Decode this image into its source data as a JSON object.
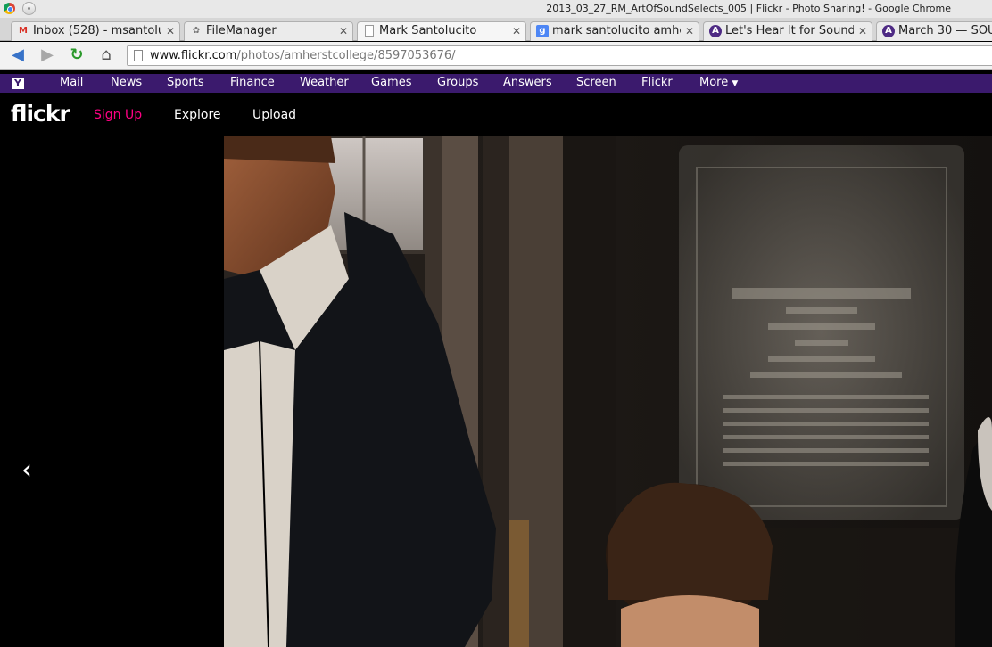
{
  "window": {
    "title": "2013_03_27_RM_ArtOfSoundSelects_005 | Flickr - Photo Sharing! - Google Chrome"
  },
  "tabs": [
    {
      "label": "Inbox (528) - msantolu",
      "icon": "gmail-icon"
    },
    {
      "label": "FileManager",
      "icon": "filemanager-icon"
    },
    {
      "label": "Mark Santolucito",
      "icon": "page-icon"
    },
    {
      "label": "mark santolucito amhe",
      "icon": "google-icon",
      "icon_glyph": "g"
    },
    {
      "label": "Let's Hear It for Sound",
      "icon": "amherst-icon",
      "icon_glyph": "A"
    },
    {
      "label": "March 30 — SOU",
      "icon": "amherst-icon",
      "icon_glyph": "A"
    }
  ],
  "toolbar": {
    "url_host": "www.flickr.com",
    "url_path": "/photos/amherstcollege/8597053676/"
  },
  "yahoo_bar": {
    "logo": "Y",
    "links": [
      "Mail",
      "News",
      "Sports",
      "Finance",
      "Weather",
      "Games",
      "Groups",
      "Answers",
      "Screen",
      "Flickr",
      "More"
    ]
  },
  "flickr_header": {
    "logo": "flickr",
    "sign_up": "Sign Up",
    "explore": "Explore",
    "upload": "Upload"
  },
  "photo": {
    "prev_arrow": "‹"
  },
  "colors": {
    "yahoo_purple": "#3b1a6d",
    "flickr_pink": "#ff0084",
    "background": "#000000"
  }
}
